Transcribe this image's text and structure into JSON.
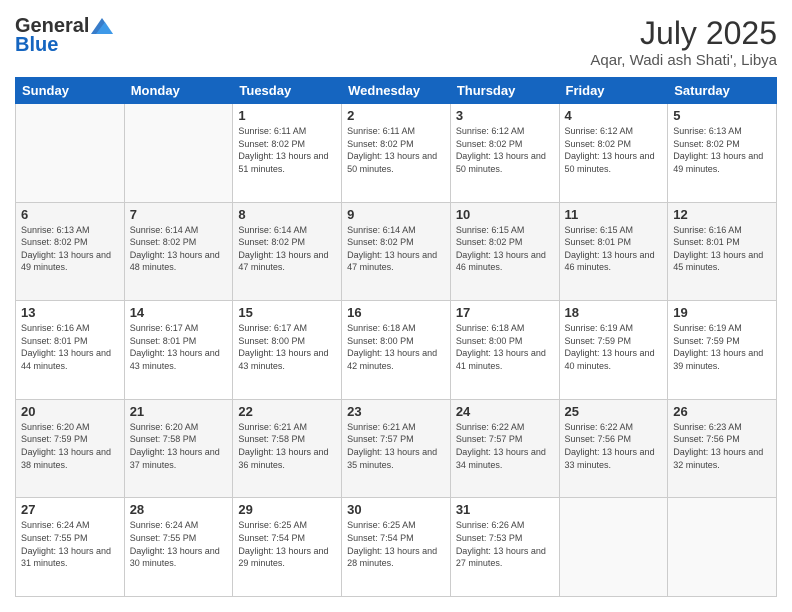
{
  "header": {
    "logo_line1": "General",
    "logo_line2": "Blue",
    "month": "July 2025",
    "location": "Aqar, Wadi ash Shati', Libya"
  },
  "weekdays": [
    "Sunday",
    "Monday",
    "Tuesday",
    "Wednesday",
    "Thursday",
    "Friday",
    "Saturday"
  ],
  "weeks": [
    [
      {
        "day": "",
        "sunrise": "",
        "sunset": "",
        "daylight": ""
      },
      {
        "day": "",
        "sunrise": "",
        "sunset": "",
        "daylight": ""
      },
      {
        "day": "1",
        "sunrise": "Sunrise: 6:11 AM",
        "sunset": "Sunset: 8:02 PM",
        "daylight": "Daylight: 13 hours and 51 minutes."
      },
      {
        "day": "2",
        "sunrise": "Sunrise: 6:11 AM",
        "sunset": "Sunset: 8:02 PM",
        "daylight": "Daylight: 13 hours and 50 minutes."
      },
      {
        "day": "3",
        "sunrise": "Sunrise: 6:12 AM",
        "sunset": "Sunset: 8:02 PM",
        "daylight": "Daylight: 13 hours and 50 minutes."
      },
      {
        "day": "4",
        "sunrise": "Sunrise: 6:12 AM",
        "sunset": "Sunset: 8:02 PM",
        "daylight": "Daylight: 13 hours and 50 minutes."
      },
      {
        "day": "5",
        "sunrise": "Sunrise: 6:13 AM",
        "sunset": "Sunset: 8:02 PM",
        "daylight": "Daylight: 13 hours and 49 minutes."
      }
    ],
    [
      {
        "day": "6",
        "sunrise": "Sunrise: 6:13 AM",
        "sunset": "Sunset: 8:02 PM",
        "daylight": "Daylight: 13 hours and 49 minutes."
      },
      {
        "day": "7",
        "sunrise": "Sunrise: 6:14 AM",
        "sunset": "Sunset: 8:02 PM",
        "daylight": "Daylight: 13 hours and 48 minutes."
      },
      {
        "day": "8",
        "sunrise": "Sunrise: 6:14 AM",
        "sunset": "Sunset: 8:02 PM",
        "daylight": "Daylight: 13 hours and 47 minutes."
      },
      {
        "day": "9",
        "sunrise": "Sunrise: 6:14 AM",
        "sunset": "Sunset: 8:02 PM",
        "daylight": "Daylight: 13 hours and 47 minutes."
      },
      {
        "day": "10",
        "sunrise": "Sunrise: 6:15 AM",
        "sunset": "Sunset: 8:02 PM",
        "daylight": "Daylight: 13 hours and 46 minutes."
      },
      {
        "day": "11",
        "sunrise": "Sunrise: 6:15 AM",
        "sunset": "Sunset: 8:01 PM",
        "daylight": "Daylight: 13 hours and 46 minutes."
      },
      {
        "day": "12",
        "sunrise": "Sunrise: 6:16 AM",
        "sunset": "Sunset: 8:01 PM",
        "daylight": "Daylight: 13 hours and 45 minutes."
      }
    ],
    [
      {
        "day": "13",
        "sunrise": "Sunrise: 6:16 AM",
        "sunset": "Sunset: 8:01 PM",
        "daylight": "Daylight: 13 hours and 44 minutes."
      },
      {
        "day": "14",
        "sunrise": "Sunrise: 6:17 AM",
        "sunset": "Sunset: 8:01 PM",
        "daylight": "Daylight: 13 hours and 43 minutes."
      },
      {
        "day": "15",
        "sunrise": "Sunrise: 6:17 AM",
        "sunset": "Sunset: 8:00 PM",
        "daylight": "Daylight: 13 hours and 43 minutes."
      },
      {
        "day": "16",
        "sunrise": "Sunrise: 6:18 AM",
        "sunset": "Sunset: 8:00 PM",
        "daylight": "Daylight: 13 hours and 42 minutes."
      },
      {
        "day": "17",
        "sunrise": "Sunrise: 6:18 AM",
        "sunset": "Sunset: 8:00 PM",
        "daylight": "Daylight: 13 hours and 41 minutes."
      },
      {
        "day": "18",
        "sunrise": "Sunrise: 6:19 AM",
        "sunset": "Sunset: 7:59 PM",
        "daylight": "Daylight: 13 hours and 40 minutes."
      },
      {
        "day": "19",
        "sunrise": "Sunrise: 6:19 AM",
        "sunset": "Sunset: 7:59 PM",
        "daylight": "Daylight: 13 hours and 39 minutes."
      }
    ],
    [
      {
        "day": "20",
        "sunrise": "Sunrise: 6:20 AM",
        "sunset": "Sunset: 7:59 PM",
        "daylight": "Daylight: 13 hours and 38 minutes."
      },
      {
        "day": "21",
        "sunrise": "Sunrise: 6:20 AM",
        "sunset": "Sunset: 7:58 PM",
        "daylight": "Daylight: 13 hours and 37 minutes."
      },
      {
        "day": "22",
        "sunrise": "Sunrise: 6:21 AM",
        "sunset": "Sunset: 7:58 PM",
        "daylight": "Daylight: 13 hours and 36 minutes."
      },
      {
        "day": "23",
        "sunrise": "Sunrise: 6:21 AM",
        "sunset": "Sunset: 7:57 PM",
        "daylight": "Daylight: 13 hours and 35 minutes."
      },
      {
        "day": "24",
        "sunrise": "Sunrise: 6:22 AM",
        "sunset": "Sunset: 7:57 PM",
        "daylight": "Daylight: 13 hours and 34 minutes."
      },
      {
        "day": "25",
        "sunrise": "Sunrise: 6:22 AM",
        "sunset": "Sunset: 7:56 PM",
        "daylight": "Daylight: 13 hours and 33 minutes."
      },
      {
        "day": "26",
        "sunrise": "Sunrise: 6:23 AM",
        "sunset": "Sunset: 7:56 PM",
        "daylight": "Daylight: 13 hours and 32 minutes."
      }
    ],
    [
      {
        "day": "27",
        "sunrise": "Sunrise: 6:24 AM",
        "sunset": "Sunset: 7:55 PM",
        "daylight": "Daylight: 13 hours and 31 minutes."
      },
      {
        "day": "28",
        "sunrise": "Sunrise: 6:24 AM",
        "sunset": "Sunset: 7:55 PM",
        "daylight": "Daylight: 13 hours and 30 minutes."
      },
      {
        "day": "29",
        "sunrise": "Sunrise: 6:25 AM",
        "sunset": "Sunset: 7:54 PM",
        "daylight": "Daylight: 13 hours and 29 minutes."
      },
      {
        "day": "30",
        "sunrise": "Sunrise: 6:25 AM",
        "sunset": "Sunset: 7:54 PM",
        "daylight": "Daylight: 13 hours and 28 minutes."
      },
      {
        "day": "31",
        "sunrise": "Sunrise: 6:26 AM",
        "sunset": "Sunset: 7:53 PM",
        "daylight": "Daylight: 13 hours and 27 minutes."
      },
      {
        "day": "",
        "sunrise": "",
        "sunset": "",
        "daylight": ""
      },
      {
        "day": "",
        "sunrise": "",
        "sunset": "",
        "daylight": ""
      }
    ]
  ]
}
